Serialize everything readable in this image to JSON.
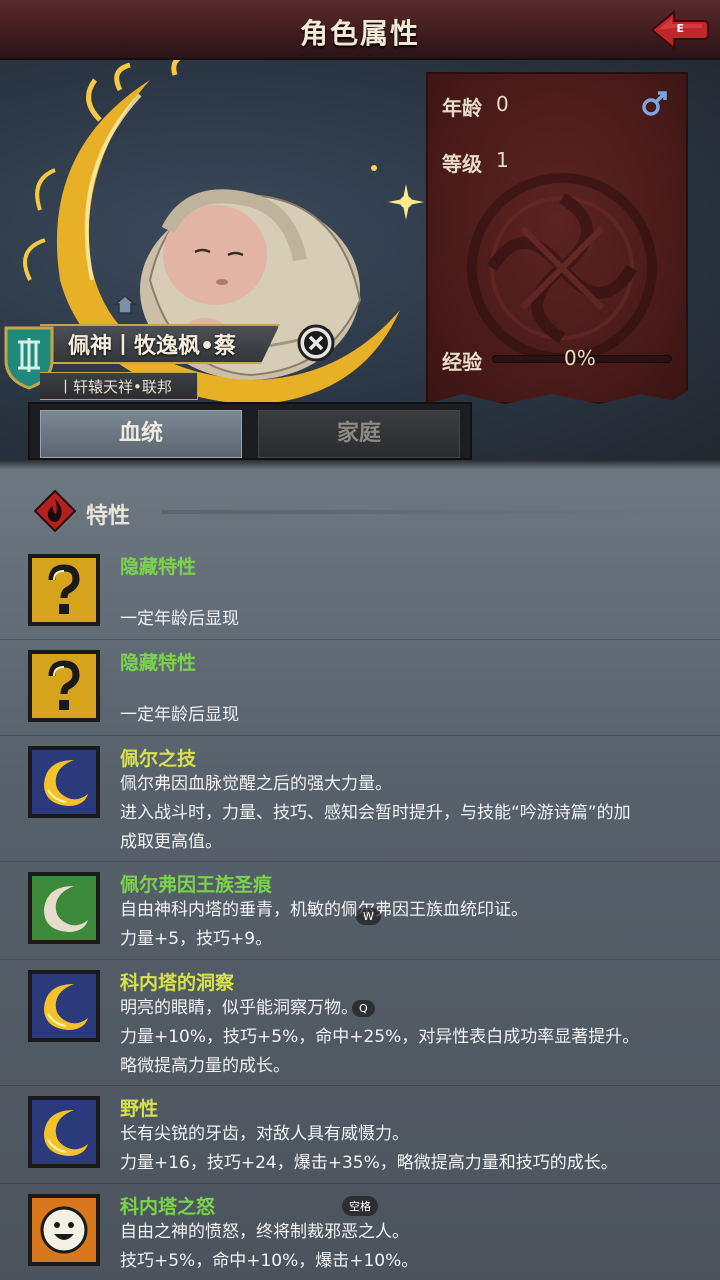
{
  "header": {
    "title": "角色属性",
    "back_key": "E"
  },
  "character": {
    "name": "佩神丨牧逸枫•蔡",
    "nation": "丨轩辕天祥•联邦"
  },
  "stats": {
    "age_label": "年龄",
    "age_value": "0",
    "level_label": "等级",
    "level_value": "1",
    "exp_label": "经验",
    "exp_value": "0%",
    "exp_fraction": 0.0
  },
  "tabs": [
    {
      "label": "血统",
      "active": true
    },
    {
      "label": "家庭",
      "active": false
    }
  ],
  "section": {
    "title": "特性"
  },
  "traits": [
    {
      "name": "隐藏特性",
      "color": "green",
      "icon": "question-mark-icon",
      "desc": [
        "",
        "一定年龄后显现"
      ]
    },
    {
      "name": "隐藏特性",
      "color": "green",
      "icon": "question-mark-icon",
      "desc": [
        "",
        "一定年龄后显现"
      ]
    },
    {
      "name": "佩尔之技",
      "color": "olive",
      "icon": "crescent-moon-icon",
      "desc": [
        "佩尔弗因血脉觉醒之后的强大力量。",
        "进入战斗时，力量、技巧、感知会暂时提升，与技能“吟游诗篇”的加",
        "成取更高值。"
      ]
    },
    {
      "name": "佩尔弗因王族圣痕",
      "color": "green",
      "icon": "white-crescent-icon",
      "desc": [
        "自由神科内塔的垂青，机敏的佩尔弗因王族血统印证。",
        "力量+5，技巧+9。"
      ]
    },
    {
      "name": "科内塔的洞察",
      "color": "olive",
      "icon": "crescent-moon-icon",
      "desc": [
        "明亮的眼睛，似乎能洞察万物。",
        "力量+10%，技巧+5%，命中+25%，对异性表白成功率显著提升。",
        "略微提高力量的成长。"
      ]
    },
    {
      "name": "野性",
      "color": "olive",
      "icon": "crescent-moon-icon",
      "desc": [
        "长有尖锐的牙齿，对敌人具有威慑力。",
        "力量+16，技巧+24，爆击+35%，略微提高力量和技巧的成长。"
      ]
    },
    {
      "name": "科内塔之怒",
      "color": "green",
      "icon": "smiley-face-icon",
      "desc": [
        "自由之神的愤怒，终将制裁邪恶之人。",
        "技巧+5%，命中+10%，爆击+10%。"
      ]
    }
  ],
  "key_hints": {
    "w": "W",
    "q": "Q",
    "space": "空格"
  }
}
